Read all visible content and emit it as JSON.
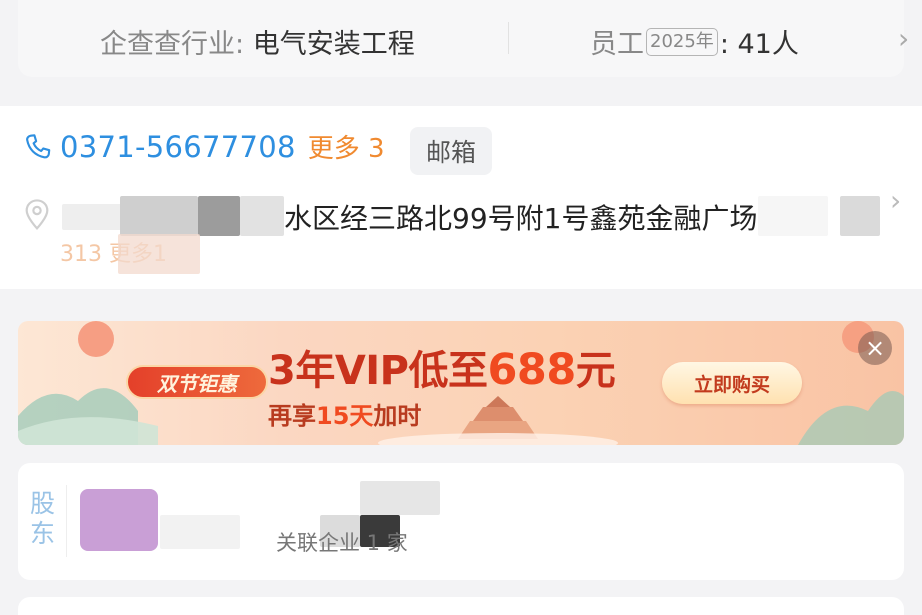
{
  "info": {
    "industry_label": "企查查行业:",
    "industry_value": "电气安装工程",
    "staff_label": "员工",
    "staff_year": "2025年",
    "staff_value": ": 41人",
    "chevron": "›"
  },
  "contact": {
    "phone": "0371-56677708",
    "phone_more": "更多 3",
    "email_button": "邮箱",
    "address_visible": "水区经三路北99号附1号鑫苑金融广场",
    "address_more": "313 更多1",
    "chevron": "›"
  },
  "banner": {
    "tag": "双节钜惠",
    "title_prefix": "3年VIP低至",
    "title_price": "688",
    "title_suffix": "元",
    "sub_prefix": "再享",
    "sub_highlight": "15天",
    "sub_suffix": "加时",
    "buy_button": "立即购买",
    "close": "×"
  },
  "shareholder": {
    "label": "股东",
    "linked": "关联企业 1 家"
  },
  "colors": {
    "accent_blue": "#2e8fe0",
    "accent_orange": "#f08a30",
    "promo_red": "#c8321c"
  }
}
